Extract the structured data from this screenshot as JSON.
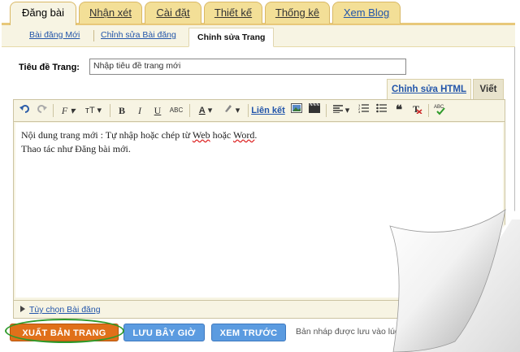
{
  "top_tabs": [
    {
      "label": "Đăng bài"
    },
    {
      "label": "Nhận xét"
    },
    {
      "label": "Cài đặt"
    },
    {
      "label": "Thiết kế"
    },
    {
      "label": "Thống kê"
    },
    {
      "label": "Xem Blog"
    }
  ],
  "sub_tabs": [
    {
      "label": "Bài đăng Mới"
    },
    {
      "label": "Chỉnh sửa Bài đăng"
    },
    {
      "label": "Chỉnh sửa Trang"
    }
  ],
  "page_title": {
    "label": "Tiêu đề Trang:",
    "value": "Nhập tiêu đề trang mới"
  },
  "editor_modes": {
    "html": "Chỉnh sửa HTML",
    "compose": "Viết"
  },
  "toolbar": {
    "font": "F",
    "font_size": "тT",
    "bold": "B",
    "italic": "I",
    "underline": "U",
    "strike": "ABC",
    "text_color": "A",
    "link": "Liên kết",
    "spell": "ABC"
  },
  "content": {
    "line1_prefix": "Nội dung trang mới : Tự nhập hoặc chép từ ",
    "line1_web": "Web",
    "line1_mid": " hoặc ",
    "line1_word": "Word",
    "line1_end": ".",
    "line2": "Thao tác như Đăng bài mới."
  },
  "post_options": "Tùy chọn Bài đăng",
  "buttons": {
    "publish": "XUẤT BẢN TRANG",
    "save": "LƯU BÂY GIỜ",
    "preview": "XEM TRƯỚC"
  },
  "draft_status": "Bản nháp được lưu vào lúc",
  "colors": {
    "tab_bg": "#f3df97",
    "panel_bg": "#f7f4e3",
    "publish": "#e0701a",
    "secondary": "#5b9be0",
    "highlight_ring": "#2e9a2a",
    "link": "#2255aa"
  }
}
